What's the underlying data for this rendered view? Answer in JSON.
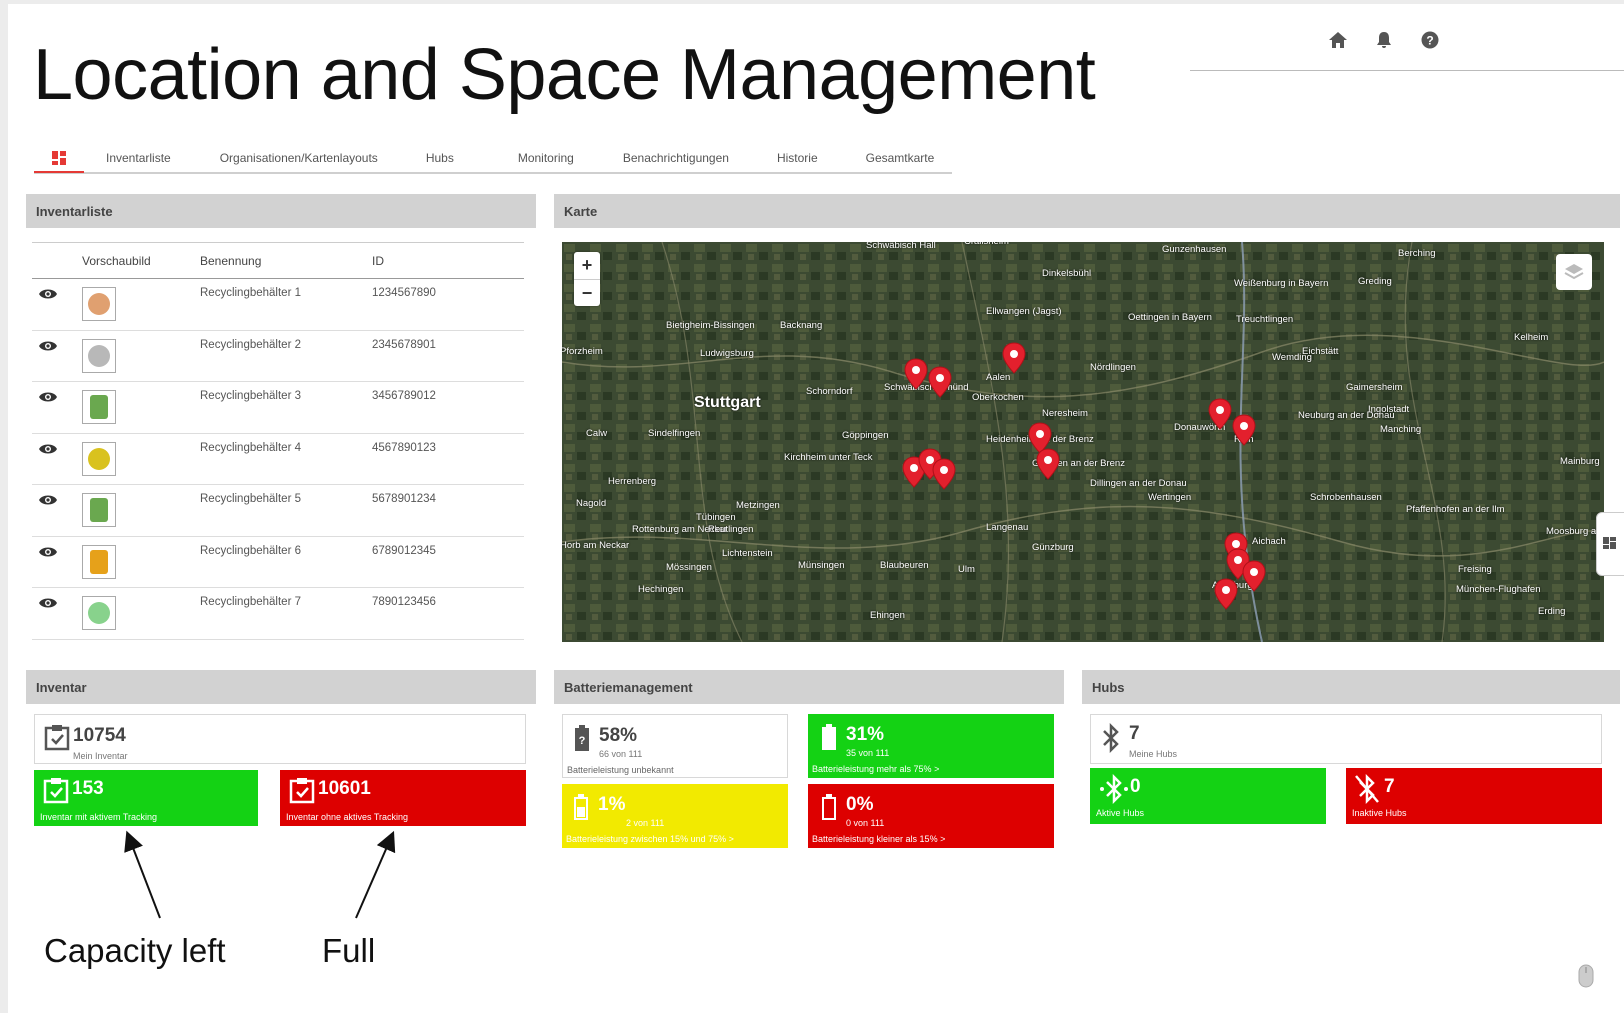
{
  "page": {
    "title": "Location and Space Management"
  },
  "header": {
    "icons": [
      "home-icon",
      "bell-icon",
      "help-icon"
    ]
  },
  "tabs": [
    "Inventarliste",
    "Organisationen/Kartenlayouts",
    "Hubs",
    "Monitoring",
    "Benachrichtigungen",
    "Historie",
    "Gesamtkarte"
  ],
  "inventory_list": {
    "title": "Inventarliste",
    "columns": [
      "Vorschaubild",
      "Benennung",
      "ID"
    ],
    "rows": [
      {
        "name": "Recyclingbehälter 1",
        "id": "1234567890",
        "color": "#e0a070",
        "shape": "round"
      },
      {
        "name": "Recyclingbehälter 2",
        "id": "2345678901",
        "color": "#b8b8b8",
        "shape": "round"
      },
      {
        "name": "Recyclingbehälter 3",
        "id": "3456789012",
        "color": "#6aa84f",
        "shape": "bin"
      },
      {
        "name": "Recyclingbehälter 4",
        "id": "4567890123",
        "color": "#d9c21e",
        "shape": "round"
      },
      {
        "name": "Recyclingbehälter 5",
        "id": "5678901234",
        "color": "#6aa84f",
        "shape": "bin"
      },
      {
        "name": "Recyclingbehälter 6",
        "id": "6789012345",
        "color": "#e6a11a",
        "shape": "bin"
      },
      {
        "name": "Recyclingbehälter 7",
        "id": "7890123456",
        "color": "#88d28c",
        "shape": "round"
      }
    ]
  },
  "map": {
    "title": "Karte",
    "zoom_in": "+",
    "zoom_out": "−",
    "labels": [
      "Schwäbisch Hall",
      "Crailsheim",
      "Dinkelsbühl",
      "Gunzenhausen",
      "Weißenburg in Bayern",
      "Greding",
      "Berching",
      "Ellwangen (Jagst)",
      "Bietigheim-Bissingen",
      "Backnang",
      "Oettingen in Bayern",
      "Treuchtlingen",
      "Pforzheim",
      "Ludwigsburg",
      "Eichstätt",
      "Kelheim",
      "Aalen",
      "Nördlingen",
      "Wemding",
      "Schorndorf",
      "Schwäbisch Gmünd",
      "Oberkochen",
      "Gaimersheim",
      "Stuttgart",
      "Ingolstadt",
      "Neresheim",
      "Donauwörth",
      "Rain",
      "Neuburg an der Donau",
      "Manching",
      "Calw",
      "Sindelfingen",
      "Göppingen",
      "Heidenheim an der Brenz",
      "Giengen an der Brenz",
      "Kirchheim unter Teck",
      "Herrenberg",
      "Dillingen an der Donau",
      "Wertingen",
      "Mainburg",
      "Nagold",
      "Metzingen",
      "Tübingen",
      "Schrobenhausen",
      "Pfaffenhofen an der Ilm",
      "Rottenburg am Neckar",
      "Reutlingen",
      "Langenau",
      "Horb am Neckar",
      "Lichtenstein",
      "Günzburg",
      "Aichach",
      "Mössingen",
      "Münsingen",
      "Blaubeuren",
      "Ulm",
      "Moosburg an der Isar",
      "Freising",
      "Hechingen",
      "Augsburg",
      "München-Flughafen",
      "Ehingen",
      "Erding"
    ]
  },
  "inventar": {
    "title": "Inventar",
    "total": {
      "value": "10754",
      "label": "Mein Inventar"
    },
    "active": {
      "value": "153",
      "label": "Inventar mit aktivem Tracking",
      "color": "#14d214"
    },
    "inactive": {
      "value": "10601",
      "label": "Inventar ohne aktives Tracking",
      "color": "#dd0000"
    }
  },
  "battery": {
    "title": "Batteriemanagement",
    "unknown": {
      "value": "58%",
      "count": "66 von 111",
      "label": "Batterieleistung unbekannt"
    },
    "high": {
      "value": "31%",
      "count": "35 von 111",
      "label": "Batterieleistung mehr als 75% >",
      "color": "#14d214"
    },
    "mid": {
      "value": "1%",
      "count": "2 von 111",
      "label": "Batterieleistung zwischen 15% und 75% >",
      "color": "#f2ea00"
    },
    "low": {
      "value": "0%",
      "count": "0 von 111",
      "label": "Batterieleistung kleiner als 15% >",
      "color": "#dd0000"
    }
  },
  "hubs": {
    "title": "Hubs",
    "total": {
      "value": "7",
      "label": "Meine Hubs"
    },
    "active": {
      "value": "0",
      "label": "Aktive Hubs"
    },
    "inactive": {
      "value": "7",
      "label": "Inaktive Hubs"
    }
  },
  "annotations": {
    "left": "Capacity left",
    "right": "Full"
  },
  "side_tab": "Dashboard"
}
